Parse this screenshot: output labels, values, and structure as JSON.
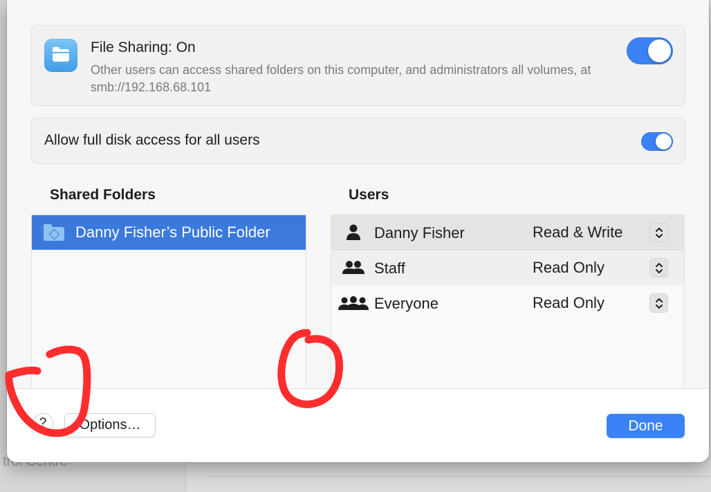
{
  "file_sharing": {
    "title": "File Sharing: On",
    "description": "Other users can access shared folders on this computer, and administrators all volumes, at smb://192.168.68.101",
    "enabled": true
  },
  "disk_access": {
    "label": "Allow full disk access for all users",
    "enabled": true
  },
  "shared_folders": {
    "title": "Shared Folders",
    "items": [
      {
        "label": "Danny Fisher’s Public Folder",
        "selected": true
      }
    ]
  },
  "users": {
    "title": "Users",
    "items": [
      {
        "name": "Danny Fisher",
        "icon": "person-icon",
        "permission": "Read & Write"
      },
      {
        "name": "Staff",
        "icon": "group-icon",
        "permission": "Read Only"
      },
      {
        "name": "Everyone",
        "icon": "everyone-icon",
        "permission": "Read Only"
      }
    ]
  },
  "footer": {
    "help_label": "?",
    "options_label": "Options…",
    "done_label": "Done"
  },
  "background": {
    "visible_text": "trol Centre"
  },
  "colors": {
    "accent": "#3b82f6",
    "selection": "#3b79dc",
    "annotation": "#ff2d2d"
  }
}
